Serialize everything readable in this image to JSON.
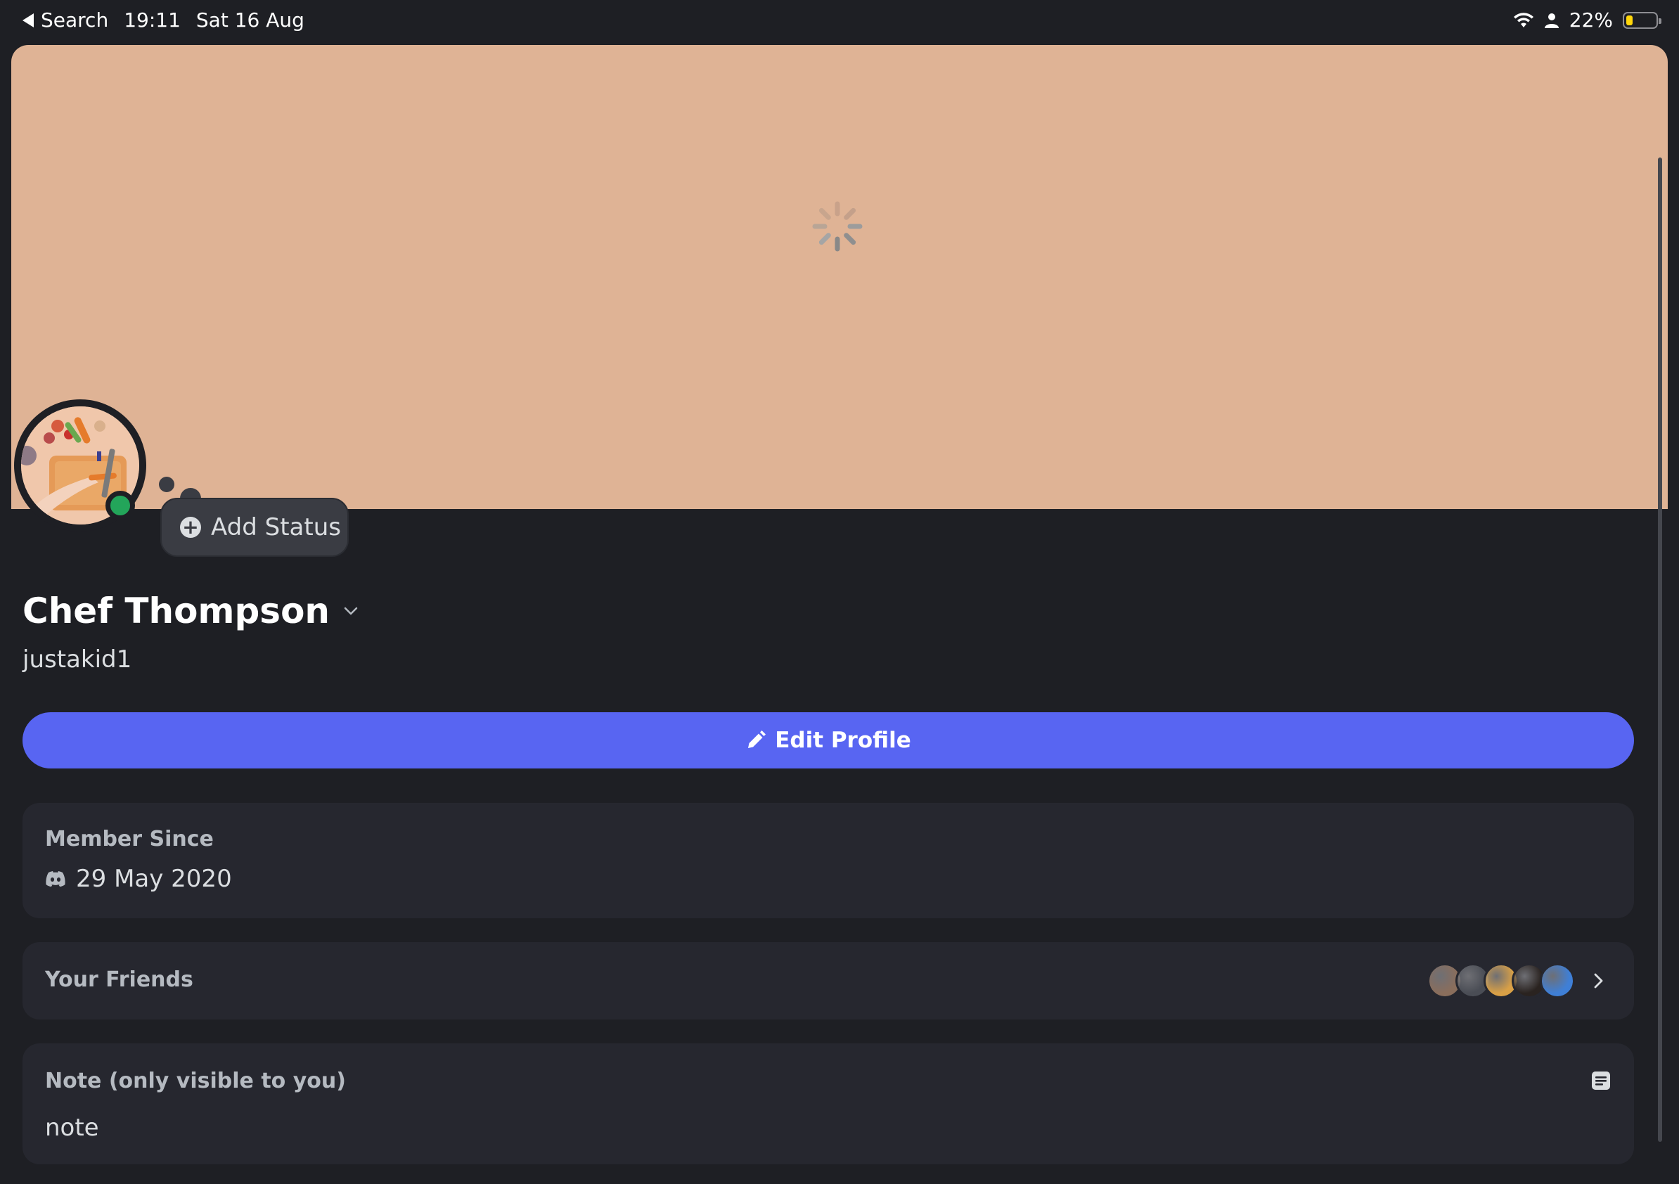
{
  "status_bar": {
    "back_label": "Search",
    "time": "19:11",
    "date": "Sat 16 Aug",
    "battery": "22%",
    "battery_level": 0.22
  },
  "profile": {
    "display_name": "Chef Thompson",
    "username": "justakid1",
    "add_status_label": "Add Status",
    "edit_profile_label": "Edit Profile"
  },
  "member_since": {
    "title": "Member Since",
    "date": "29 May 2020"
  },
  "friends": {
    "title": "Your Friends",
    "avatar_colors": [
      "#8a6e5c",
      "#4a4d55",
      "#d9a046",
      "#2a2320",
      "#3f7fd6"
    ]
  },
  "note": {
    "title": "Note (only visible to you)",
    "placeholder": "note"
  },
  "colors": {
    "banner": "#dfb395",
    "accent": "#5865f2",
    "online": "#23a55a",
    "card": "#26272f",
    "background": "#1e1f24"
  }
}
